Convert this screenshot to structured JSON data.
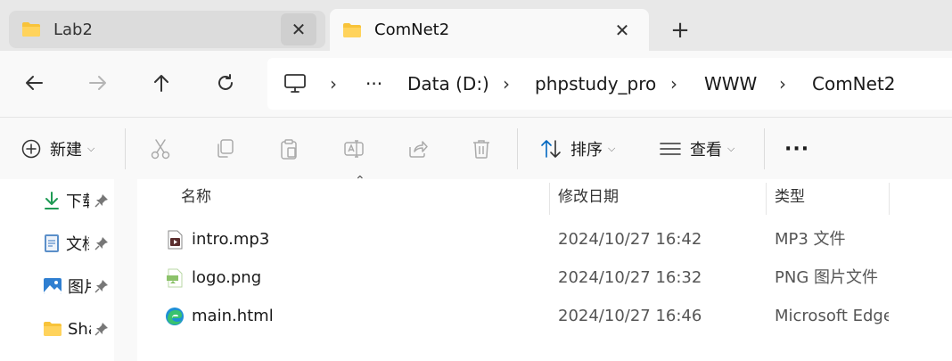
{
  "tabs": [
    {
      "label": "Lab2",
      "active": false,
      "icon": "folder-icon"
    },
    {
      "label": "ComNet2",
      "active": true,
      "icon": "folder-icon"
    }
  ],
  "tab_close_glyph": "✕",
  "new_tab_glyph": "+",
  "breadcrumb": {
    "overflow": "···",
    "items": [
      "Data (D:)",
      "phpstudy_pro",
      "WWW",
      "ComNet2"
    ],
    "separator": "›"
  },
  "toolbar": {
    "new_label": "新建",
    "sort_label": "排序",
    "view_label": "查看",
    "more_glyph": "···"
  },
  "sidebar": {
    "items": [
      {
        "label": "下载",
        "icon": "download-icon"
      },
      {
        "label": "文档",
        "icon": "document-icon"
      },
      {
        "label": "图片",
        "icon": "pictures-icon"
      },
      {
        "label": "Sha",
        "icon": "folder-icon"
      }
    ]
  },
  "columns": {
    "name": "名称",
    "modified": "修改日期",
    "type": "类型"
  },
  "files": [
    {
      "name": "intro.mp3",
      "modified": "2024/10/27 16:42",
      "type": "MP3 文件",
      "icon": "audio-file-icon"
    },
    {
      "name": "logo.png",
      "modified": "2024/10/27 16:32",
      "type": "PNG 图片文件",
      "icon": "image-file-icon"
    },
    {
      "name": "main.html",
      "modified": "2024/10/27 16:46",
      "type": "Microsoft Edge",
      "icon": "edge-icon"
    }
  ],
  "colors": {
    "accent": "#0067c0",
    "folder": "#f8c33a",
    "tabbar": "#e8e8e8"
  }
}
